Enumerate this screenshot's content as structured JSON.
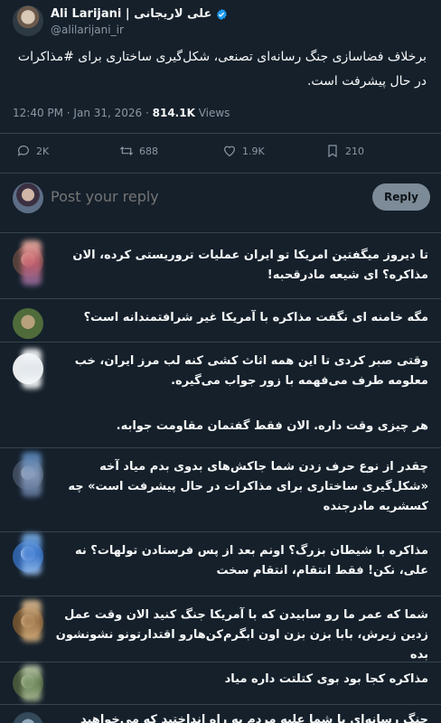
{
  "header": {
    "display_name": "Ali Larijani | علی لاریجانی",
    "handle": "@alilarijani_ir"
  },
  "tweet": {
    "text": "برخلاف فضاسازی جنگ رسانه‌ای تصنعی، شکل‌گیری ساختاری برای #مذاکرات در حال پیشرفت است.",
    "time": "12:40 PM · Jan 31, 2026 · ",
    "views_count": "814.1K",
    "views_label": " Views"
  },
  "actions": {
    "replies": "2K",
    "reposts": "688",
    "likes": "1.9K",
    "bookmarks": "210"
  },
  "composer": {
    "placeholder": "Post your reply",
    "button_label": "Reply"
  },
  "replies": [
    {
      "text": "تا دیروز میگفتین امریکا تو ایران عملیات تروریستی کرده، الان مذاکره؟ ای شیعه مادرقحبه!"
    },
    {
      "text": "مگه خامنه ای نگفت مذاکره با آمریکا غیر شرافتمندانه است؟"
    },
    {
      "text": "وقتی صبر کردی تا این همه اثاث کشی کنه لب مرز ایران، خب معلومه طرف می‌فهمه با زور جواب می‌گیره."
    },
    {
      "text": "هر چیزی وقت داره. الان فقط گفتمان مقاومت جوابه."
    },
    {
      "text": "چقدر از نوع حرف زدن شما جاکش‌های بدوی بدم میاد آخه «شکل‌گیری ساختاری برای مذاکرات در حال پیشرفت است» چه کسشریه مادرجنده"
    },
    {
      "text": "مذاکره با شیطان بزرگ؟ اونم بعد از پس فرستادن تولهات؟ نه علی، نکن! فقط انتقام، انتقام سخت"
    },
    {
      "text": "شما که عمر ما رو سابیدن که با آمریکا جنگ کنید الان وقت عمل زدین زیرش، بابا بزن بزن اون ابگرم‌کن‌هارو اقتدارتونو نشونشون بده"
    },
    {
      "text": "مذاکره کجا بود بوی کتلتت داره میاد"
    },
    {
      "text": "جنگ رسانه‌ای با شما علیه مردم به راه انداختید که می‌خواهید بگویید"
    }
  ]
}
